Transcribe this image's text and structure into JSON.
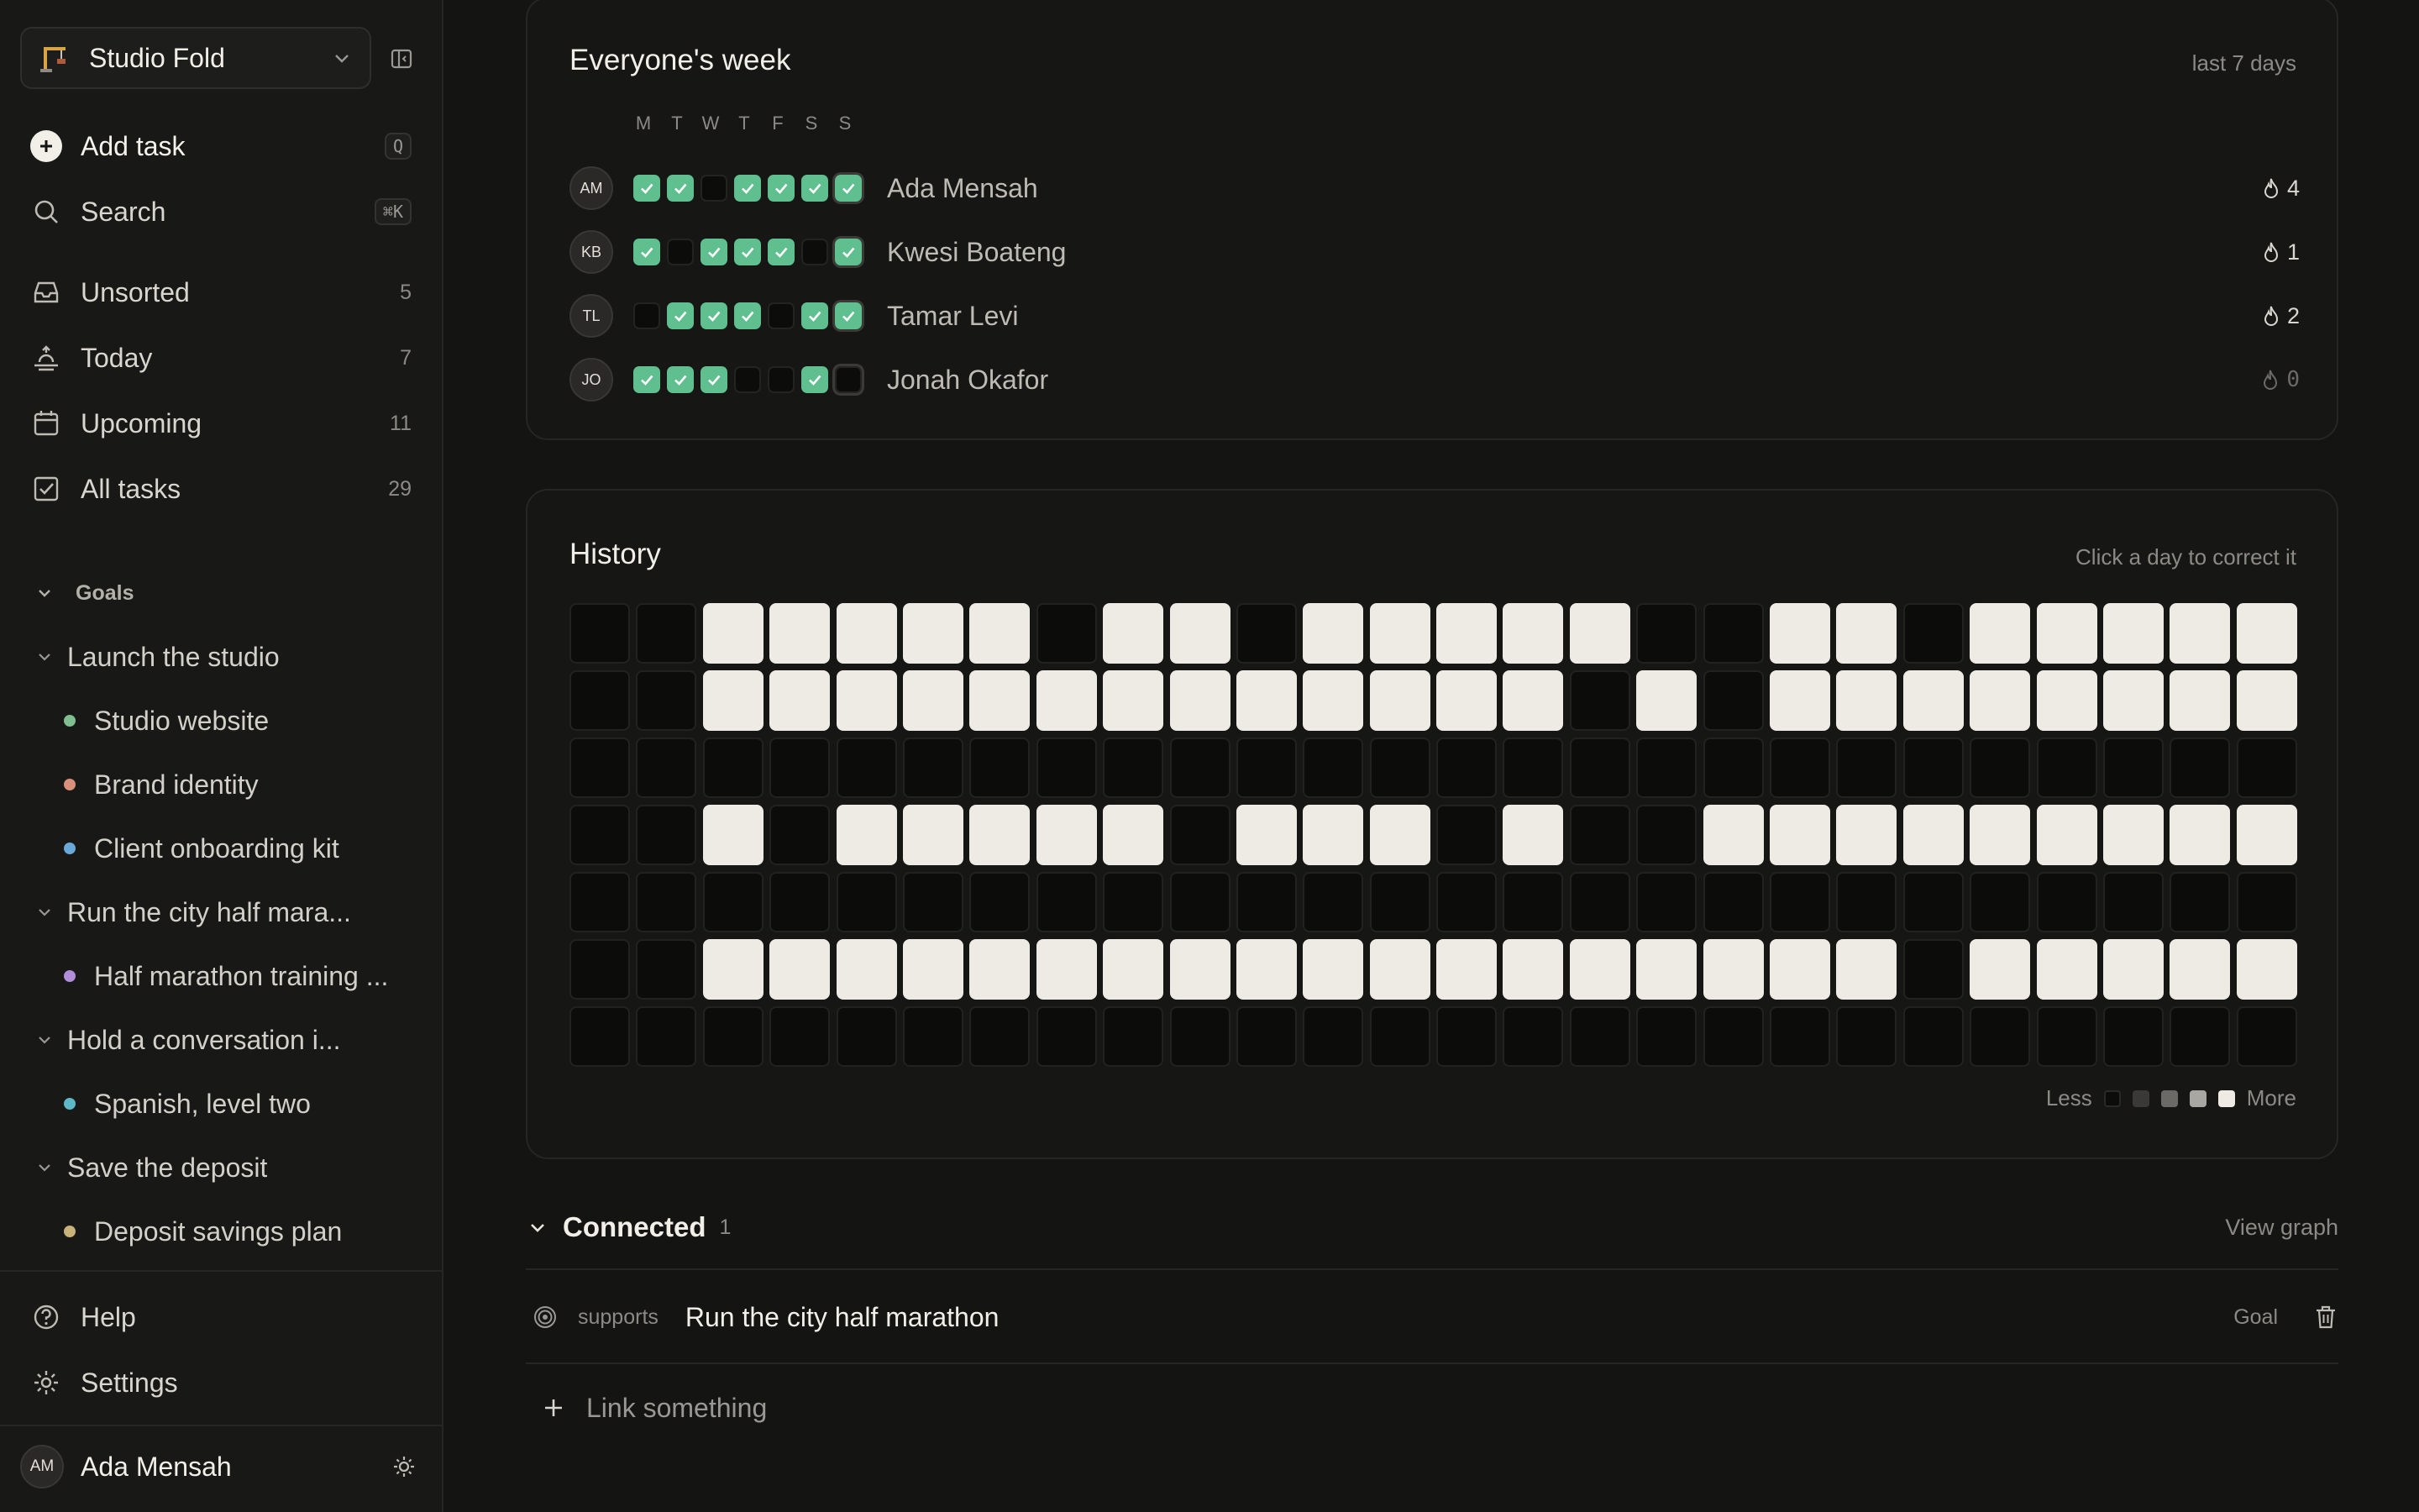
{
  "workspace": {
    "name": "Studio Fold"
  },
  "sidebar": {
    "add_task": {
      "label": "Add task",
      "shortcut": "Q"
    },
    "search": {
      "label": "Search",
      "shortcut": "⌘K"
    },
    "nav": [
      {
        "label": "Unsorted",
        "count": "5",
        "icon": "inbox-icon"
      },
      {
        "label": "Today",
        "count": "7",
        "icon": "sunrise-icon"
      },
      {
        "label": "Upcoming",
        "count": "11",
        "icon": "calendar-icon"
      },
      {
        "label": "All tasks",
        "count": "29",
        "icon": "checkbox-icon"
      }
    ],
    "goals_label": "Goals",
    "goals": [
      {
        "label": "Launch the studio",
        "items": [
          {
            "label": "Studio website",
            "color": "#7fbf8f"
          },
          {
            "label": "Brand identity",
            "color": "#d9907a"
          },
          {
            "label": "Client onboarding kit",
            "color": "#6aa8d8"
          }
        ]
      },
      {
        "label": "Run the city half mara...",
        "items": [
          {
            "label": "Half marathon training ...",
            "color": "#b08fd8"
          }
        ]
      },
      {
        "label": "Hold a conversation i...",
        "items": [
          {
            "label": "Spanish, level two",
            "color": "#5fb8c8"
          }
        ]
      },
      {
        "label": "Save the deposit",
        "items": [
          {
            "label": "Deposit savings plan",
            "color": "#c8b27a"
          }
        ]
      }
    ],
    "help": "Help",
    "settings": "Settings",
    "user": {
      "initials": "AM",
      "name": "Ada Mensah"
    }
  },
  "week": {
    "title": "Everyone's week",
    "range": "last 7 days",
    "days": [
      "M",
      "T",
      "W",
      "T",
      "F",
      "S",
      "S"
    ],
    "members": [
      {
        "initials": "AM",
        "name": "Ada Mensah",
        "streak": "4",
        "checks": [
          1,
          1,
          0,
          1,
          1,
          1,
          1
        ]
      },
      {
        "initials": "KB",
        "name": "Kwesi Boateng",
        "streak": "1",
        "checks": [
          1,
          0,
          1,
          1,
          1,
          0,
          1
        ]
      },
      {
        "initials": "TL",
        "name": "Tamar Levi",
        "streak": "2",
        "checks": [
          0,
          1,
          1,
          1,
          0,
          1,
          1
        ]
      },
      {
        "initials": "JO",
        "name": "Jonah Okafor",
        "streak": "0",
        "checks": [
          1,
          1,
          1,
          0,
          0,
          1,
          0
        ]
      }
    ]
  },
  "history": {
    "title": "History",
    "hint": "Click a day to correct it",
    "legend_less": "Less",
    "legend_more": "More",
    "legend_colors": [
      "#0c0c0b",
      "#3a3937",
      "#6b6a66",
      "#a9a7a1",
      "#edebe4"
    ],
    "grid": [
      [
        0,
        0,
        4,
        4,
        4,
        4,
        4,
        0,
        4,
        4,
        0,
        4,
        4,
        4,
        4,
        4,
        0,
        0,
        4,
        4,
        0,
        4,
        4,
        4,
        4,
        4
      ],
      [
        0,
        0,
        4,
        4,
        4,
        4,
        4,
        4,
        4,
        4,
        4,
        4,
        4,
        4,
        4,
        0,
        4,
        0,
        4,
        4,
        4,
        4,
        4,
        4,
        4,
        4
      ],
      [
        0,
        0,
        0,
        0,
        0,
        0,
        0,
        0,
        0,
        0,
        0,
        0,
        0,
        0,
        0,
        0,
        0,
        0,
        0,
        0,
        0,
        0,
        0,
        0,
        0,
        0
      ],
      [
        0,
        0,
        4,
        0,
        4,
        4,
        4,
        4,
        4,
        0,
        4,
        4,
        4,
        0,
        4,
        0,
        0,
        4,
        4,
        4,
        4,
        4,
        4,
        4,
        4,
        4
      ],
      [
        0,
        0,
        0,
        0,
        0,
        0,
        0,
        0,
        0,
        0,
        0,
        0,
        0,
        0,
        0,
        0,
        0,
        0,
        0,
        0,
        0,
        0,
        0,
        0,
        0,
        0
      ],
      [
        0,
        0,
        4,
        4,
        4,
        4,
        4,
        4,
        4,
        4,
        4,
        4,
        4,
        4,
        4,
        4,
        4,
        4,
        4,
        4,
        0,
        4,
        4,
        4,
        4,
        4
      ],
      [
        0,
        0,
        0,
        0,
        0,
        0,
        0,
        0,
        0,
        0,
        0,
        0,
        0,
        0,
        0,
        0,
        0,
        0,
        0,
        0,
        0,
        0,
        0,
        0,
        0,
        0
      ]
    ]
  },
  "connected": {
    "title": "Connected",
    "count": "1",
    "view_graph": "View graph",
    "links": [
      {
        "relation": "supports",
        "target": "Run the city half marathon",
        "kind": "Goal"
      }
    ],
    "add_label": "Link something"
  }
}
